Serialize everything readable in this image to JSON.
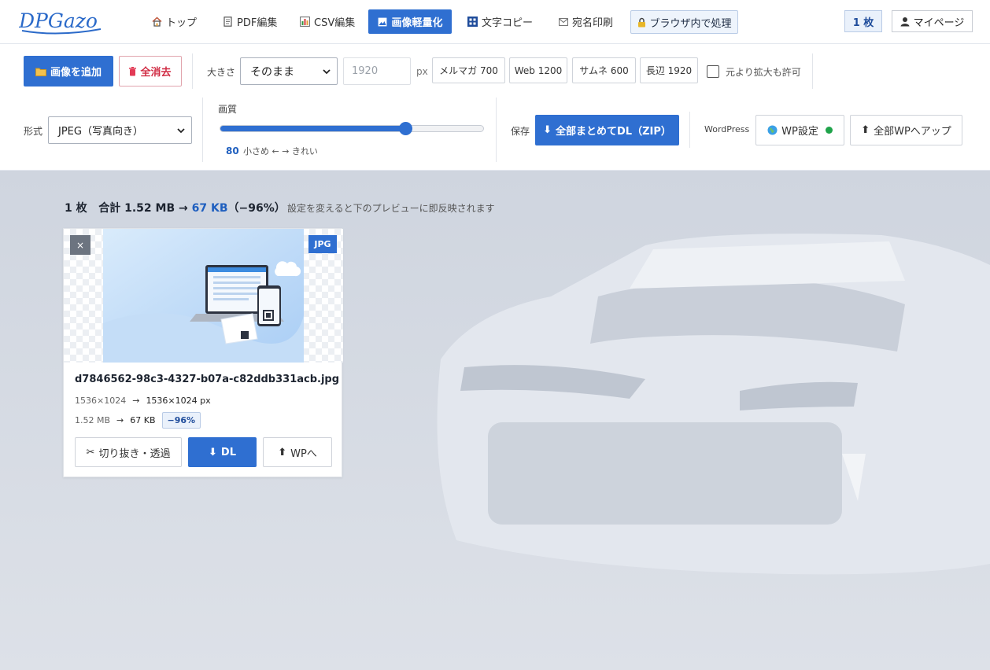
{
  "header": {
    "logo_text": "DPGazo",
    "nav": [
      {
        "label": "トップ",
        "icon": "home-icon"
      },
      {
        "label": "PDF編集",
        "icon": "document-icon"
      },
      {
        "label": "CSV編集",
        "icon": "bar-chart-icon"
      },
      {
        "label": "画像軽量化",
        "icon": "image-icon"
      },
      {
        "label": "文字コピー",
        "icon": "grid-icon"
      },
      {
        "label": "宛名印刷",
        "icon": "envelope-icon"
      },
      {
        "label": "ブラウザ内で処理",
        "icon": "lock-icon"
      }
    ],
    "active_nav": "画像軽量化",
    "count_label": "1 枚",
    "mypage_label": "マイページ"
  },
  "toolbar": {
    "add_image_label": "画像を追加",
    "clear_all_label": "全消去",
    "size_label": "大きさ",
    "size_select_value": "そのまま",
    "width_placeholder": "1920",
    "px_unit": "px",
    "presets": [
      "メルマガ 700",
      "Web 1200",
      "サムネ 600",
      "長辺 1920"
    ],
    "allow_upscale_label": "元より拡大も許可",
    "allow_upscale_checked": false,
    "format_label": "形式",
    "format_select_value": "JPEG（写真向き）",
    "quality_label": "画質",
    "quality_value": "80",
    "quality_slider_fraction": 0.705,
    "quality_hint": "小さめ ← → きれい",
    "save_label": "保存",
    "download_all_label": "全部まとめてDL（ZIP）",
    "wordpress_label": "WordPress",
    "wp_settings_label": "WP設定",
    "wp_status_color": "#1fa34a",
    "upload_all_wp_label": "全部WPへアップ"
  },
  "summary": {
    "count": "1 枚",
    "total_prefix": "合計 1.52 MB →",
    "total_after": "67 KB",
    "reduction": "（−96%）",
    "hint": "設定を変えると下のプレビューに即反映されます"
  },
  "card": {
    "close_label": "×",
    "format_badge": "JPG",
    "filename": "d7846562-98c3-4327-b07a-c82ddb331acb.jpg",
    "dimensions_before": "1536×1024",
    "dimensions_after": "1536×1024 px",
    "size_before": "1.52 MB",
    "size_after": "67 KB",
    "reduction_badge": "−96%",
    "crop_label": "切り抜き・透過",
    "dl_label": "DL",
    "wp_label": "WPへ"
  },
  "colors": {
    "primary": "#2f6fd1",
    "danger": "#d02b43",
    "background": "#d6dbe4"
  }
}
